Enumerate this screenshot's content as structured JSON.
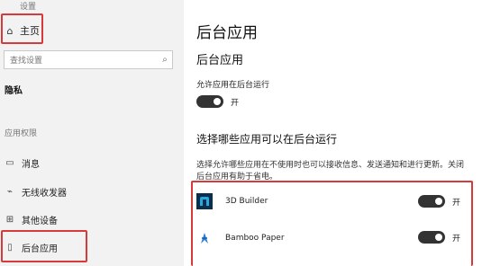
{
  "sidebar": {
    "window_title": "设置",
    "home_label": "主页",
    "search_placeholder": "查找设置",
    "privacy_heading": "隐私",
    "app_permissions_heading": "应用权限",
    "items": [
      {
        "label": "消息",
        "icon": "message-icon"
      },
      {
        "label": "无线收发器",
        "icon": "radio-icon"
      },
      {
        "label": "其他设备",
        "icon": "devices-icon"
      },
      {
        "label": "后台应用",
        "icon": "background-apps-icon"
      }
    ]
  },
  "main": {
    "page_title": "后台应用",
    "section_title": "后台应用",
    "allow_label": "允许应用在后台运行",
    "allow_state": "开",
    "choose_title": "选择哪些应用可以在后台运行",
    "description": "选择允许哪些应用在不使用时也可以接收信息、发送通知和进行更新。关闭后台应用有助于省电。",
    "apps": [
      {
        "name": "3D Builder",
        "state": "开",
        "icon": "3d-builder-icon"
      },
      {
        "name": "Bamboo Paper",
        "state": "开",
        "icon": "bamboo-paper-icon"
      }
    ]
  },
  "colors": {
    "highlight_box": "#d63a3a",
    "toggle_on": "#333333",
    "sidebar_bg": "#f2f2f2",
    "app_icon_3d": "#0b6fa8",
    "app_icon_bamboo": "#2a7fd4"
  }
}
